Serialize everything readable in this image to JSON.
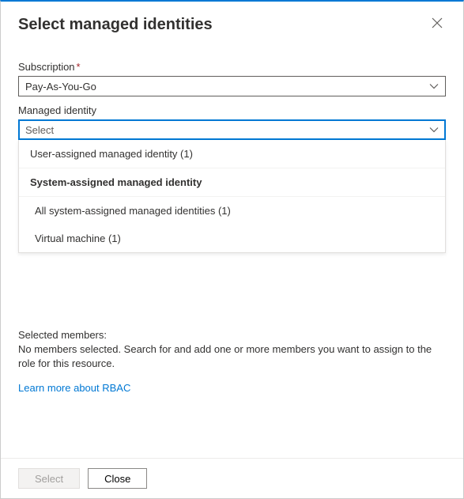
{
  "header": {
    "title": "Select managed identities"
  },
  "subscription": {
    "label": "Subscription",
    "required": "*",
    "value": "Pay-As-You-Go"
  },
  "managedIdentity": {
    "label": "Managed identity",
    "placeholder": "Select",
    "dropdown": {
      "userAssigned": "User-assigned managed identity (1)",
      "systemHeader": "System-assigned managed identity",
      "allSystem": "All system-assigned managed identities (1)",
      "vm": "Virtual machine (1)"
    }
  },
  "selected": {
    "label": "Selected members:",
    "message": "No members selected. Search for and add one or more members you want to assign to the role for this resource.",
    "link": "Learn more about RBAC"
  },
  "footer": {
    "select": "Select",
    "close": "Close"
  }
}
